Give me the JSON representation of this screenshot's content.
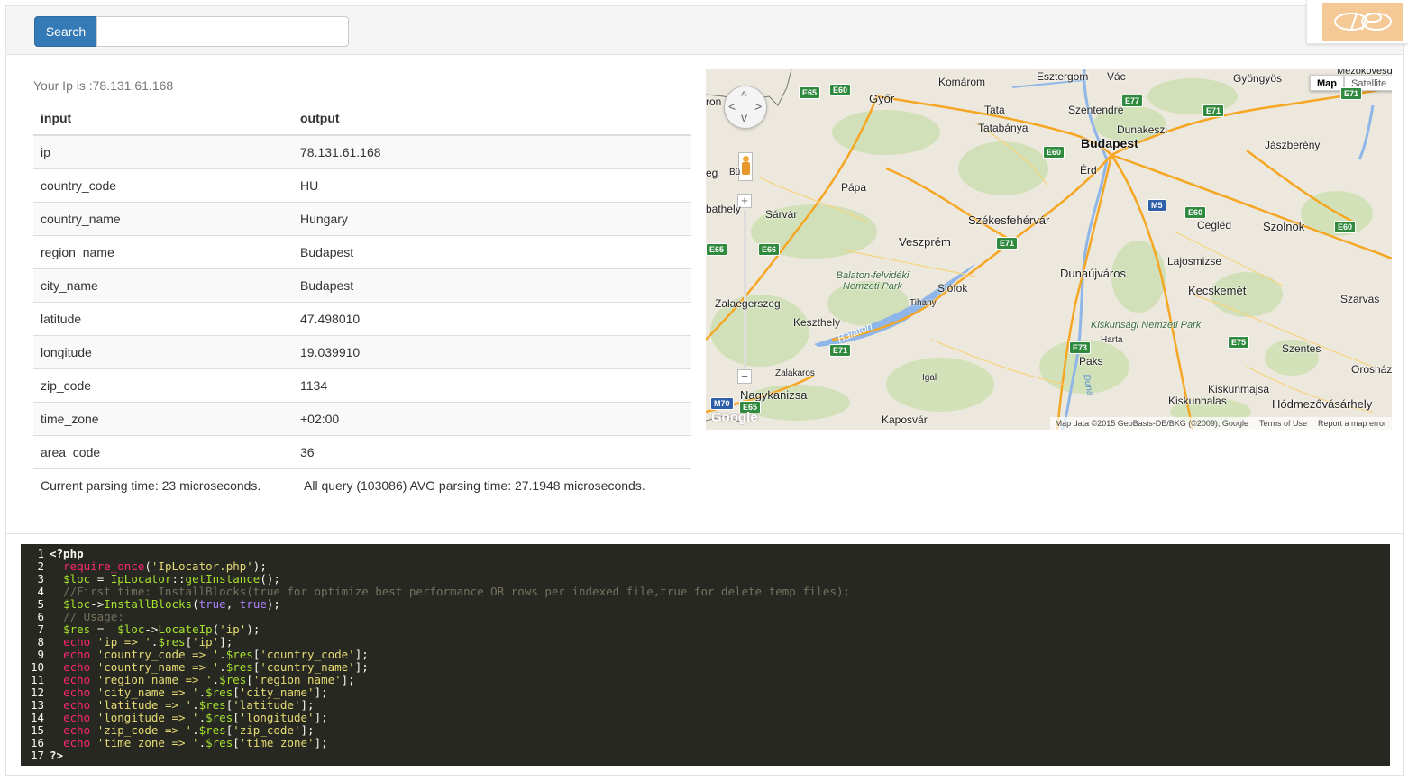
{
  "search": {
    "button_label": "Search",
    "placeholder": "",
    "value": ""
  },
  "your_ip": "Your Ip is :78.131.61.168",
  "table": {
    "headers": [
      "input",
      "output"
    ],
    "rows": [
      [
        "ip",
        "78.131.61.168"
      ],
      [
        "country_code",
        "HU"
      ],
      [
        "country_name",
        "Hungary"
      ],
      [
        "region_name",
        "Budapest"
      ],
      [
        "city_name",
        "Budapest"
      ],
      [
        "latitude",
        "47.498010"
      ],
      [
        "longitude",
        "19.039910"
      ],
      [
        "zip_code",
        "1134"
      ],
      [
        "time_zone",
        "+02:00"
      ],
      [
        "area_code",
        "36"
      ]
    ]
  },
  "timing": {
    "current": "Current parsing time: 23 microseconds.",
    "avg": "All query (103086) AVG parsing time: 27.1948 microseconds."
  },
  "map": {
    "type_buttons": [
      "Map",
      "Satellite"
    ],
    "active_type": "Map",
    "zoom_in": "+",
    "zoom_out": "−",
    "google": "Google",
    "footer": [
      "Map data ©2015 GeoBasis-DE/BKG (©2009), Google",
      "Terms of Use",
      "Report a map error"
    ],
    "labels": {
      "esztergom": "Esztergom",
      "vac": "Vác",
      "gyongyos": "Gyöngyös",
      "mezokovesd": "Mezőkövesd",
      "komarom": "Komárom",
      "gyor": "Győr",
      "tata": "Tata",
      "tatabanya": "Tatabánya",
      "szentendre": "Szentendre",
      "dunakeszi": "Dunakeszi",
      "budapest": "Budapest",
      "jaszbereny": "Jászberény",
      "erd": "Érd",
      "papa": "Pápa",
      "sarvar": "Sárvár",
      "szekesfehervar": "Székesfehérvár",
      "cegled": "Cegléd",
      "szolnok": "Szolnok",
      "veszprem": "Veszprém",
      "lajosmizse": "Lajosmizse",
      "balaton_park": "Balaton-felvidéki Nemzeti Park",
      "siofok": "Siófok",
      "tihany": "Tihany",
      "dunaujvaros": "Dunaújváros",
      "kecskemet": "Kecskemét",
      "szarvas": "Szarvas",
      "zalaegerszeg": "Zalaegerszeg",
      "keszthely": "Keszthely",
      "balaton": "Balaton",
      "kiskunsagi": "Kiskunsági Nemzeti Park",
      "harta": "Harta",
      "szentes": "Szentes",
      "paks": "Paks",
      "oroshaza": "Orosháza",
      "zalakaros": "Zalakaros",
      "igal": "Igal",
      "kiskunmajsa": "Kiskunmajsa",
      "nagykanizsa": "Nagykanizsa",
      "kiskunhalas": "Kiskunhalas",
      "hodmezovasarhely": "Hódmezővásárhely",
      "kaposvar": "Kaposvár",
      "duna": "Duna",
      "szombathely": "bathely",
      "left_bu": "Bü",
      "left_eg": "eg",
      "left_ron": "ron"
    },
    "shields": {
      "e65a": "E65",
      "e60a": "E60",
      "e77": "E77",
      "e71a": "E71",
      "e71b": "E71",
      "e60b": "E60",
      "m5": "M5",
      "e60c": "E60",
      "e60d": "E60",
      "e65b": "E65",
      "e66": "E66",
      "e71c": "E71",
      "e73": "E73",
      "e75": "E75",
      "e71d": "E71",
      "m70": "M70",
      "e65c": "E65"
    }
  },
  "code": {
    "lines": [
      "<?php",
      "  require_once('IpLocator.php');",
      "  $loc = IpLocator::getInstance();",
      "  //First time: InstallBlocks(true for optimize best performance OR rows per indexed file,true for delete temp files);",
      "  $loc->InstallBlocks(true, true);",
      "  // Usage:",
      "  $res =  $loc->LocateIp('ip');",
      "  echo 'ip => '.$res['ip'];",
      "  echo 'country_code => '.$res['country_code'];",
      "  echo 'country_name => '.$res['country_name'];",
      "  echo 'region_name => '.$res['region_name'];",
      "  echo 'city_name => '.$res['city_name'];",
      "  echo 'latitude => '.$res['latitude'];",
      "  echo 'longitude => '.$res['longitude'];",
      "  echo 'zip_code => '.$res['zip_code'];",
      "  echo 'time_zone => '.$res['time_zone'];",
      "?>"
    ]
  },
  "colors": {
    "accent": "#337ab7",
    "code_bg": "#272822",
    "code_keyword": "#f92672",
    "code_string": "#e6db74",
    "code_var": "#a6e22e",
    "code_comment": "#75715e",
    "code_const": "#ae81ff",
    "map_lake": "#8fb6e8",
    "map_road": "#f5a623"
  }
}
